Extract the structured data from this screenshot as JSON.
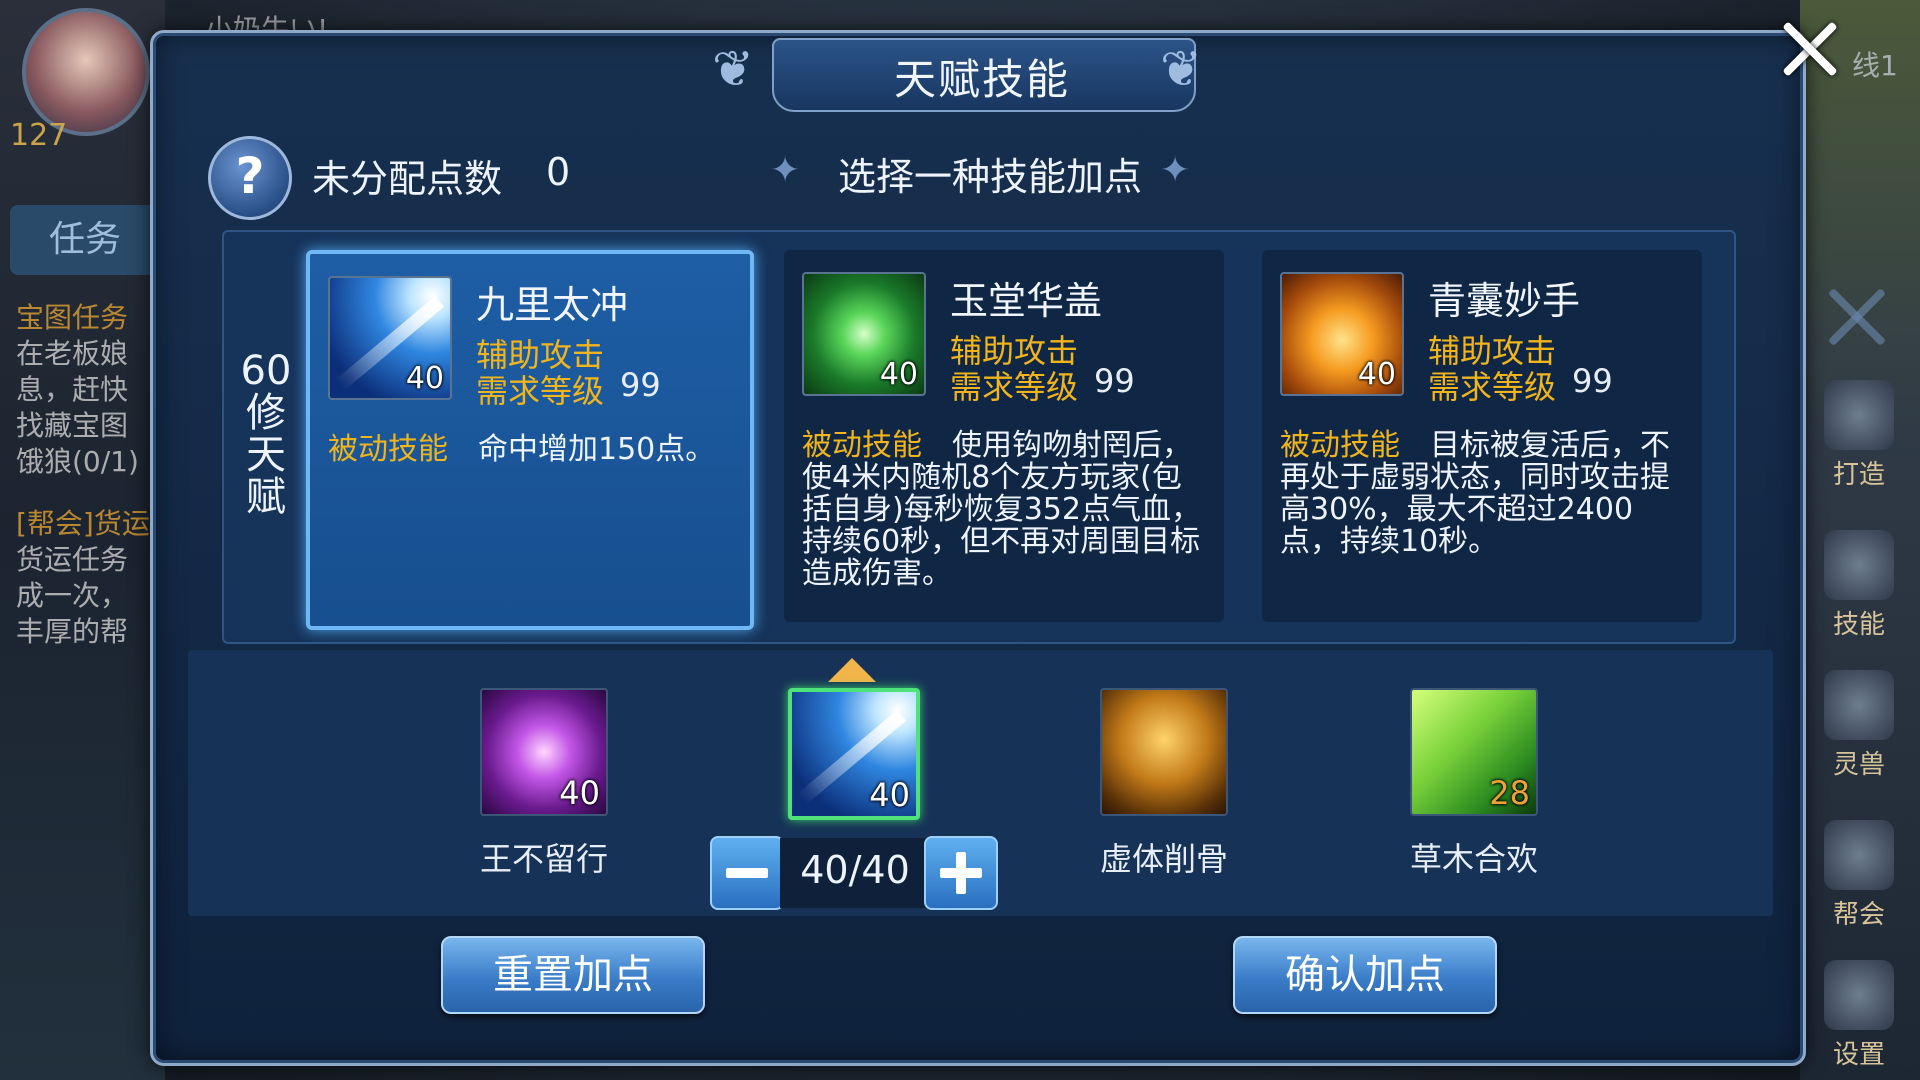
{
  "background": {
    "player_level": "127",
    "top_name": "小奶牛い!",
    "task_tab": "任务",
    "task_lines": [
      "宝图任务",
      "在老板娘",
      "息，赶快",
      "找藏宝图",
      "饿狼(0/1)",
      "[帮会]货运",
      "货运任务",
      "成一次，",
      "丰厚的帮"
    ],
    "line_label": "线1",
    "side_buttons": [
      "打造",
      "技能",
      "灵兽",
      "帮会",
      "设置"
    ]
  },
  "dialog": {
    "title": "天赋技能",
    "unallocated_label": "未分配点数",
    "unallocated_value": "0",
    "hint": "选择一种技能加点",
    "help_icon": "?",
    "tier_label": "60修天赋"
  },
  "talents": [
    {
      "name": "九里太冲",
      "icon": "light-beam-icon",
      "level": "40",
      "type": "辅助攻击",
      "req_label": "需求等级",
      "req_value": "99",
      "passive_label": "被动技能",
      "desc": "命中增加150点。",
      "selected": true
    },
    {
      "name": "玉堂华盖",
      "icon": "green-clover-icon",
      "level": "40",
      "type": "辅助攻击",
      "req_label": "需求等级",
      "req_value": "99",
      "passive_label": "被动技能",
      "desc": "使用钩吻射罔后，使4米内随机8个友方玩家(包括自身)每秒恢复352点气血，持续60秒，但不再对周围目标造成伤害。",
      "selected": false
    },
    {
      "name": "青囊妙手",
      "icon": "glowing-hand-icon",
      "level": "40",
      "type": "辅助攻击",
      "req_label": "需求等级",
      "req_value": "99",
      "passive_label": "被动技能",
      "desc": "目标被复活后，不再处于虚弱状态，同时攻击提高30%，最大不超过2400点，持续10秒。",
      "selected": false
    }
  ],
  "skills": [
    {
      "name": "王不留行",
      "icon": "lightning-hand-icon",
      "level": "40"
    },
    {
      "name": "",
      "icon": "light-beam-icon",
      "level": "40",
      "active": true
    },
    {
      "name": "虚体削骨",
      "icon": "kneeling-figure-icon",
      "level": ""
    },
    {
      "name": "草木合欢",
      "icon": "leaves-icon",
      "level": "28"
    }
  ],
  "stepper": {
    "value": "40/40"
  },
  "buttons": {
    "reset": "重置加点",
    "confirm": "确认加点"
  },
  "colors": {
    "accent_gold": "#f0b41c",
    "selected_border": "#6fb8f5",
    "active_green": "#4ee37a",
    "button_blue": "#3a7cc8"
  }
}
